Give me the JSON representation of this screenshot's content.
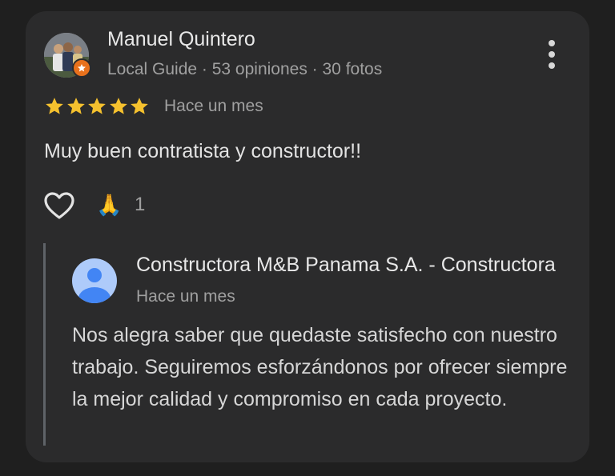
{
  "review": {
    "author_name": "Manuel Quintero",
    "author_meta": "Local Guide · 53 opiniones · 30 fotos",
    "rating": 5,
    "time": "Hace un mes",
    "text": "Muy buen contratista y constructor!!",
    "reaction_emoji": "🙏",
    "reaction_count": "1"
  },
  "reply": {
    "owner_name": "Constructora M&B Panama S.A. - Constructora",
    "time": "Hace un mes",
    "text": "Nos alegra saber que quedaste satisfecho con nuestro trabajo. Seguiremos esforzándonos por ofrecer siempre la mejor calidad y compromiso en cada proyecto."
  },
  "icons": {
    "more": "more-vert-icon",
    "like": "heart-outline-icon",
    "star": "star-icon",
    "badge": "local-guide-badge-icon",
    "owner_avatar": "person-avatar-icon"
  },
  "colors": {
    "background": "#1f1f1f",
    "card": "#2b2b2c",
    "star": "#f5c12e",
    "badge": "#e8711c",
    "owner_avatar_bg": "#aecbfa",
    "owner_avatar_fg": "#4285f4"
  }
}
